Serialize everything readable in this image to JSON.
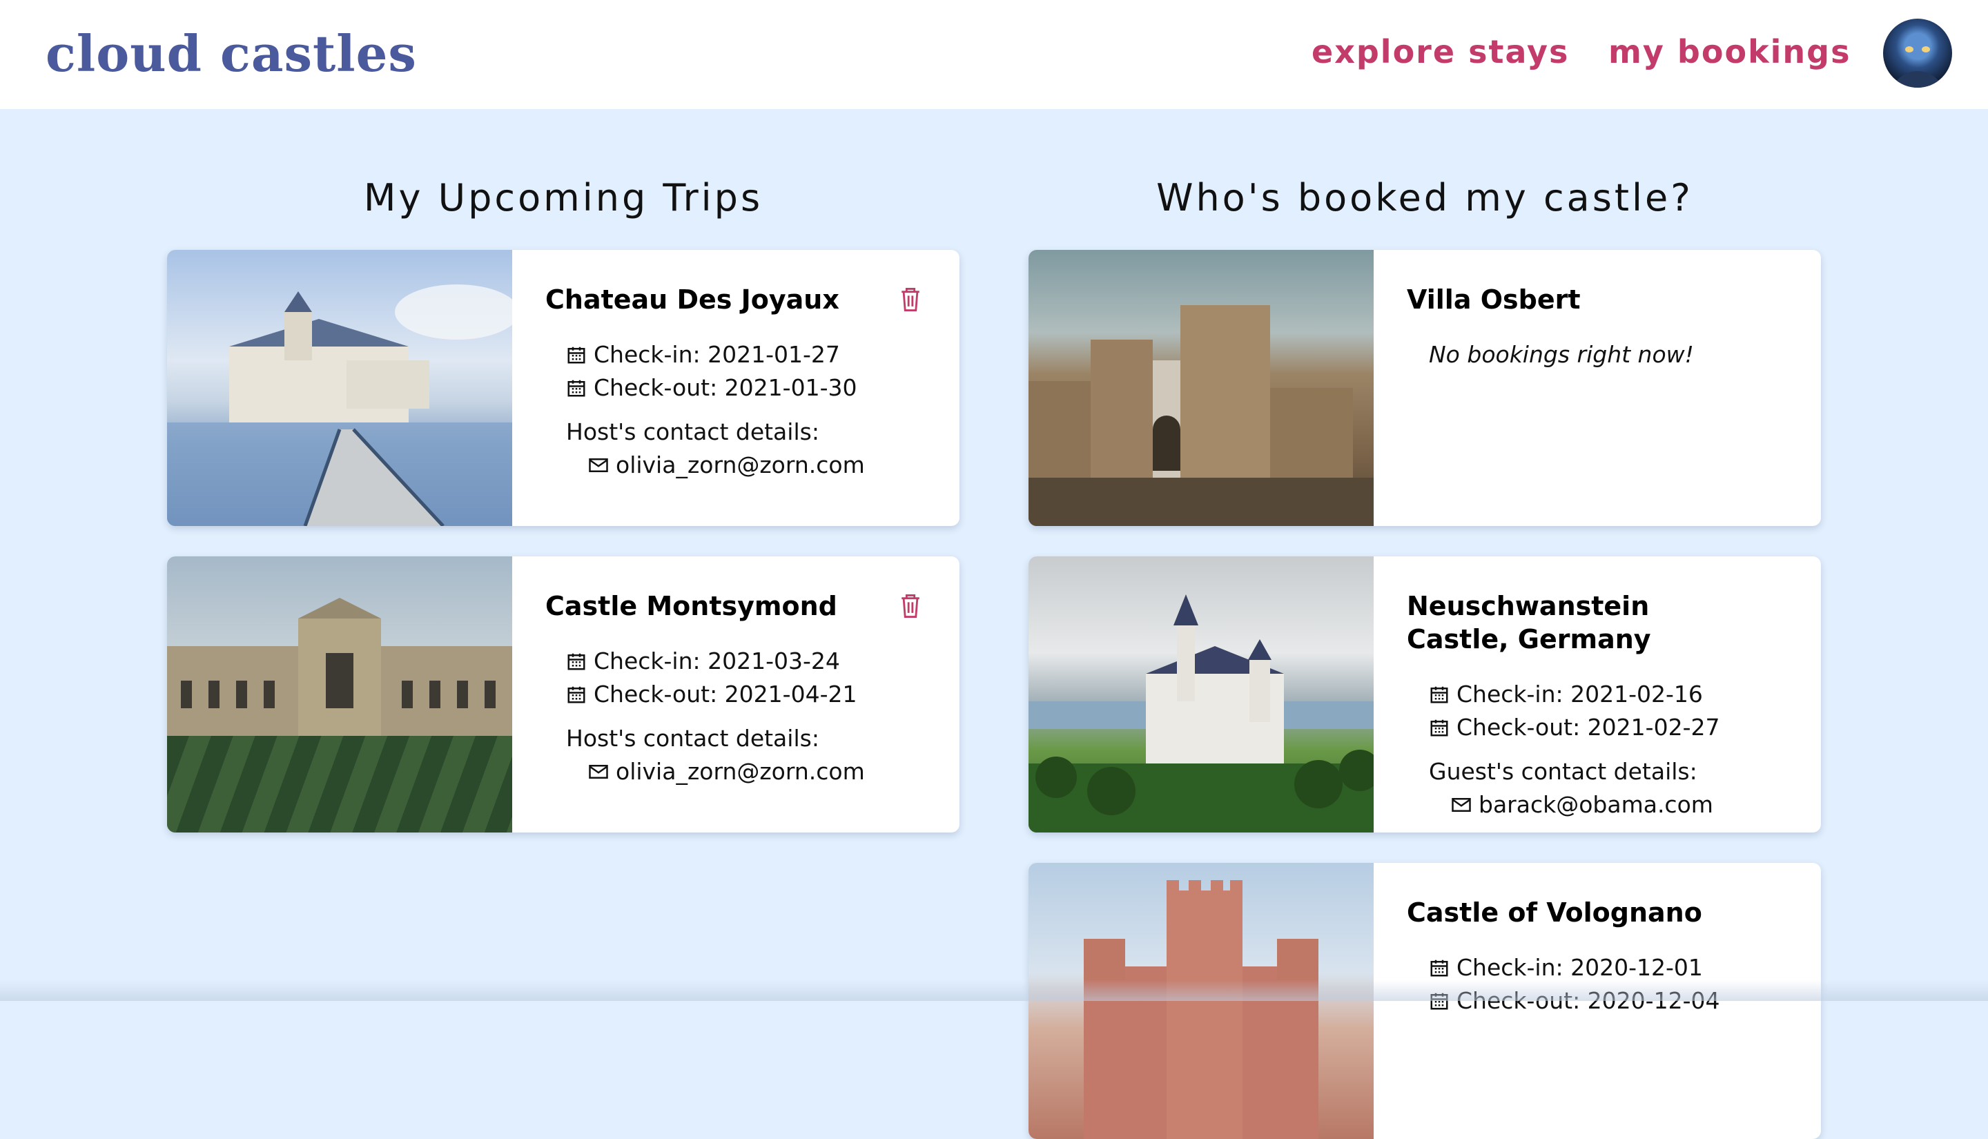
{
  "header": {
    "logo": "cloud castles",
    "nav": {
      "explore": "explore stays",
      "bookings": "my bookings"
    },
    "avatar_icon": "user-avatar"
  },
  "columns": {
    "left_title": "My Upcoming Trips",
    "right_title": "Who's booked my castle?"
  },
  "trips": [
    {
      "name": "Chateau Des Joyaux",
      "checkin": "Check-in: 2021-01-27",
      "checkout": "Check-out: 2021-01-30",
      "contact_label": "Host's contact details:",
      "email": "olivia_zorn@zorn.com",
      "delete_icon": "trash-icon"
    },
    {
      "name": "Castle Montsymond",
      "checkin": "Check-in: 2021-03-24",
      "checkout": "Check-out: 2021-04-21",
      "contact_label": "Host's contact details:",
      "email": "olivia_zorn@zorn.com",
      "delete_icon": "trash-icon"
    }
  ],
  "castles": [
    {
      "name": "Villa Osbert",
      "empty_message": "No bookings right now!"
    },
    {
      "name": "Neuschwanstein Castle, Germany",
      "checkin": "Check-in: 2021-02-16",
      "checkout": "Check-out: 2021-02-27",
      "contact_label": "Guest's contact details:",
      "email": "barack@obama.com"
    },
    {
      "name": "Castle of Volognano",
      "checkin": "Check-in: 2020-12-01",
      "checkout": "Check-out: 2020-12-04"
    }
  ],
  "colors": {
    "accent": "#c23b6a",
    "logo": "#4a5a9c",
    "background": "#e1effe"
  }
}
